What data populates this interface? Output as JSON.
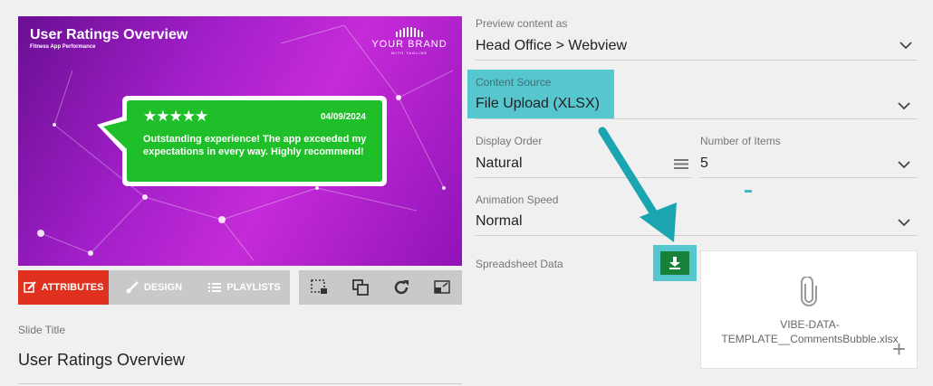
{
  "preview": {
    "title": "User Ratings Overview",
    "subtitle": "Fitness App Performance",
    "brand_name": "YOUR BRAND",
    "brand_tagline": "WITH TAGLINE",
    "bubble": {
      "rating": 5,
      "stars": "★★★★★",
      "date": "04/09/2024",
      "text": "Outstanding experience! The app exceeded my expectations in every way. Highly recommend!"
    },
    "colors": {
      "background": "#a21fc9",
      "bubble": "#1fbf2a"
    }
  },
  "tabs": [
    {
      "label": "ATTRIBUTES",
      "icon": "edit-icon",
      "active": true
    },
    {
      "label": "DESIGN",
      "icon": "brush-icon",
      "active": false
    },
    {
      "label": "PLAYLISTS",
      "icon": "list-icon",
      "active": false
    }
  ],
  "tools": [
    "select-area-icon",
    "layers-icon",
    "refresh-icon",
    "resize-icon"
  ],
  "slide_title": {
    "label": "Slide Title",
    "value": "User Ratings Overview"
  },
  "preview_as": {
    "label": "Preview content as",
    "value": "Head Office > Webview"
  },
  "content_source": {
    "label": "Content Source",
    "value": "File Upload (XLSX)"
  },
  "display_order": {
    "label": "Display Order",
    "value": "Natural"
  },
  "number_of_items": {
    "label": "Number of Items",
    "value": "5"
  },
  "animation_speed": {
    "label": "Animation Speed",
    "value": "Normal"
  },
  "spreadsheet": {
    "label": "Spreadsheet Data",
    "file_name": "VIBE-DATA-TEMPLATE__CommentsBubble.xlsx",
    "plus": "+"
  },
  "accent_colors": {
    "active_tab": "#e0311f",
    "highlight": "#56c7cf",
    "download": "#17813a"
  }
}
